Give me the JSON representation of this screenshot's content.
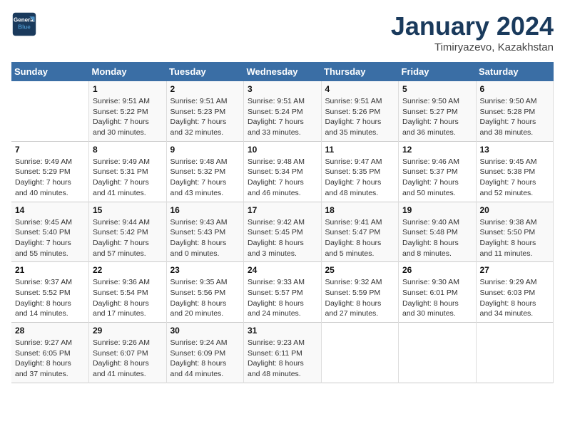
{
  "logo": {
    "line1": "General",
    "line2": "Blue"
  },
  "title": "January 2024",
  "subtitle": "Timiryazevo, Kazakhstan",
  "weekdays": [
    "Sunday",
    "Monday",
    "Tuesday",
    "Wednesday",
    "Thursday",
    "Friday",
    "Saturday"
  ],
  "weeks": [
    [
      {
        "day": "",
        "sunrise": "",
        "sunset": "",
        "daylight": ""
      },
      {
        "day": "1",
        "sunrise": "Sunrise: 9:51 AM",
        "sunset": "Sunset: 5:22 PM",
        "daylight": "Daylight: 7 hours and 30 minutes."
      },
      {
        "day": "2",
        "sunrise": "Sunrise: 9:51 AM",
        "sunset": "Sunset: 5:23 PM",
        "daylight": "Daylight: 7 hours and 32 minutes."
      },
      {
        "day": "3",
        "sunrise": "Sunrise: 9:51 AM",
        "sunset": "Sunset: 5:24 PM",
        "daylight": "Daylight: 7 hours and 33 minutes."
      },
      {
        "day": "4",
        "sunrise": "Sunrise: 9:51 AM",
        "sunset": "Sunset: 5:26 PM",
        "daylight": "Daylight: 7 hours and 35 minutes."
      },
      {
        "day": "5",
        "sunrise": "Sunrise: 9:50 AM",
        "sunset": "Sunset: 5:27 PM",
        "daylight": "Daylight: 7 hours and 36 minutes."
      },
      {
        "day": "6",
        "sunrise": "Sunrise: 9:50 AM",
        "sunset": "Sunset: 5:28 PM",
        "daylight": "Daylight: 7 hours and 38 minutes."
      }
    ],
    [
      {
        "day": "7",
        "sunrise": "Sunrise: 9:49 AM",
        "sunset": "Sunset: 5:29 PM",
        "daylight": "Daylight: 7 hours and 40 minutes."
      },
      {
        "day": "8",
        "sunrise": "Sunrise: 9:49 AM",
        "sunset": "Sunset: 5:31 PM",
        "daylight": "Daylight: 7 hours and 41 minutes."
      },
      {
        "day": "9",
        "sunrise": "Sunrise: 9:48 AM",
        "sunset": "Sunset: 5:32 PM",
        "daylight": "Daylight: 7 hours and 43 minutes."
      },
      {
        "day": "10",
        "sunrise": "Sunrise: 9:48 AM",
        "sunset": "Sunset: 5:34 PM",
        "daylight": "Daylight: 7 hours and 46 minutes."
      },
      {
        "day": "11",
        "sunrise": "Sunrise: 9:47 AM",
        "sunset": "Sunset: 5:35 PM",
        "daylight": "Daylight: 7 hours and 48 minutes."
      },
      {
        "day": "12",
        "sunrise": "Sunrise: 9:46 AM",
        "sunset": "Sunset: 5:37 PM",
        "daylight": "Daylight: 7 hours and 50 minutes."
      },
      {
        "day": "13",
        "sunrise": "Sunrise: 9:45 AM",
        "sunset": "Sunset: 5:38 PM",
        "daylight": "Daylight: 7 hours and 52 minutes."
      }
    ],
    [
      {
        "day": "14",
        "sunrise": "Sunrise: 9:45 AM",
        "sunset": "Sunset: 5:40 PM",
        "daylight": "Daylight: 7 hours and 55 minutes."
      },
      {
        "day": "15",
        "sunrise": "Sunrise: 9:44 AM",
        "sunset": "Sunset: 5:42 PM",
        "daylight": "Daylight: 7 hours and 57 minutes."
      },
      {
        "day": "16",
        "sunrise": "Sunrise: 9:43 AM",
        "sunset": "Sunset: 5:43 PM",
        "daylight": "Daylight: 8 hours and 0 minutes."
      },
      {
        "day": "17",
        "sunrise": "Sunrise: 9:42 AM",
        "sunset": "Sunset: 5:45 PM",
        "daylight": "Daylight: 8 hours and 3 minutes."
      },
      {
        "day": "18",
        "sunrise": "Sunrise: 9:41 AM",
        "sunset": "Sunset: 5:47 PM",
        "daylight": "Daylight: 8 hours and 5 minutes."
      },
      {
        "day": "19",
        "sunrise": "Sunrise: 9:40 AM",
        "sunset": "Sunset: 5:48 PM",
        "daylight": "Daylight: 8 hours and 8 minutes."
      },
      {
        "day": "20",
        "sunrise": "Sunrise: 9:38 AM",
        "sunset": "Sunset: 5:50 PM",
        "daylight": "Daylight: 8 hours and 11 minutes."
      }
    ],
    [
      {
        "day": "21",
        "sunrise": "Sunrise: 9:37 AM",
        "sunset": "Sunset: 5:52 PM",
        "daylight": "Daylight: 8 hours and 14 minutes."
      },
      {
        "day": "22",
        "sunrise": "Sunrise: 9:36 AM",
        "sunset": "Sunset: 5:54 PM",
        "daylight": "Daylight: 8 hours and 17 minutes."
      },
      {
        "day": "23",
        "sunrise": "Sunrise: 9:35 AM",
        "sunset": "Sunset: 5:56 PM",
        "daylight": "Daylight: 8 hours and 20 minutes."
      },
      {
        "day": "24",
        "sunrise": "Sunrise: 9:33 AM",
        "sunset": "Sunset: 5:57 PM",
        "daylight": "Daylight: 8 hours and 24 minutes."
      },
      {
        "day": "25",
        "sunrise": "Sunrise: 9:32 AM",
        "sunset": "Sunset: 5:59 PM",
        "daylight": "Daylight: 8 hours and 27 minutes."
      },
      {
        "day": "26",
        "sunrise": "Sunrise: 9:30 AM",
        "sunset": "Sunset: 6:01 PM",
        "daylight": "Daylight: 8 hours and 30 minutes."
      },
      {
        "day": "27",
        "sunrise": "Sunrise: 9:29 AM",
        "sunset": "Sunset: 6:03 PM",
        "daylight": "Daylight: 8 hours and 34 minutes."
      }
    ],
    [
      {
        "day": "28",
        "sunrise": "Sunrise: 9:27 AM",
        "sunset": "Sunset: 6:05 PM",
        "daylight": "Daylight: 8 hours and 37 minutes."
      },
      {
        "day": "29",
        "sunrise": "Sunrise: 9:26 AM",
        "sunset": "Sunset: 6:07 PM",
        "daylight": "Daylight: 8 hours and 41 minutes."
      },
      {
        "day": "30",
        "sunrise": "Sunrise: 9:24 AM",
        "sunset": "Sunset: 6:09 PM",
        "daylight": "Daylight: 8 hours and 44 minutes."
      },
      {
        "day": "31",
        "sunrise": "Sunrise: 9:23 AM",
        "sunset": "Sunset: 6:11 PM",
        "daylight": "Daylight: 8 hours and 48 minutes."
      },
      {
        "day": "",
        "sunrise": "",
        "sunset": "",
        "daylight": ""
      },
      {
        "day": "",
        "sunrise": "",
        "sunset": "",
        "daylight": ""
      },
      {
        "day": "",
        "sunrise": "",
        "sunset": "",
        "daylight": ""
      }
    ]
  ]
}
